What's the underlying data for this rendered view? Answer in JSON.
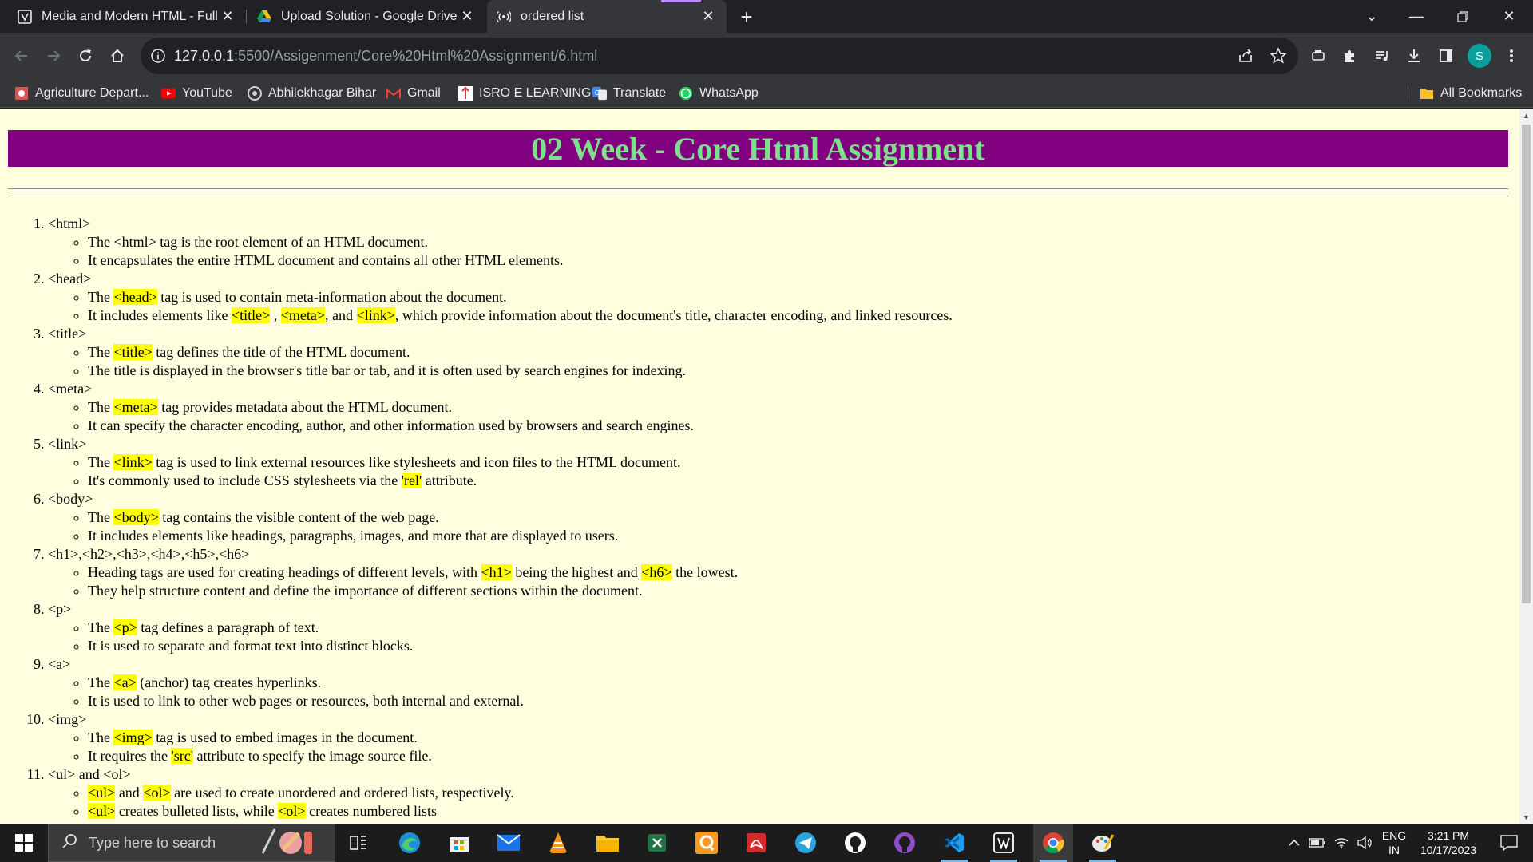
{
  "browser": {
    "tabs": [
      {
        "title": "Media and Modern HTML - Full",
        "active": false
      },
      {
        "title": "Upload Solution - Google Drive",
        "active": false
      },
      {
        "title": "ordered list",
        "active": true
      }
    ],
    "address": {
      "host": "127.0.0.1",
      "path": ":5500/Assigenment/Core%20Html%20Assignment/6.html"
    },
    "profile_initial": "S",
    "bookmarks": [
      "Agriculture Depart...",
      "YouTube",
      "Abhilekhagar Bihar",
      "Gmail",
      "ISRO E LEARNING",
      "Translate",
      "WhatsApp"
    ],
    "all_bookmarks": "All Bookmarks"
  },
  "page": {
    "heading": "02 Week - Core Html Assignment",
    "items": [
      {
        "tag": "<html>",
        "points": [
          [
            {
              "t": "The <html> tag is the root element of an HTML document."
            }
          ],
          [
            {
              "t": "It encapsulates the entire HTML document and contains all other HTML elements."
            }
          ]
        ]
      },
      {
        "tag": "<head>",
        "points": [
          [
            {
              "t": "The "
            },
            {
              "t": "<head>",
              "h": true
            },
            {
              "t": " tag is used to contain meta-information about the document."
            }
          ],
          [
            {
              "t": "It includes elements like "
            },
            {
              "t": "<title>",
              "h": true
            },
            {
              "t": " , "
            },
            {
              "t": "<meta>",
              "h": true
            },
            {
              "t": ", and "
            },
            {
              "t": "<link>",
              "h": true
            },
            {
              "t": ", which provide information about the document's title, character encoding, and linked resources."
            }
          ]
        ]
      },
      {
        "tag": "<title>",
        "points": [
          [
            {
              "t": "The "
            },
            {
              "t": "<title>",
              "h": true
            },
            {
              "t": " tag defines the title of the HTML document."
            }
          ],
          [
            {
              "t": "The title is displayed in the browser's title bar or tab, and it is often used by search engines for indexing."
            }
          ]
        ]
      },
      {
        "tag": "<meta>",
        "points": [
          [
            {
              "t": "The "
            },
            {
              "t": "<meta>",
              "h": true
            },
            {
              "t": " tag provides metadata about the HTML document."
            }
          ],
          [
            {
              "t": "It can specify the character encoding, author, and other information used by browsers and search engines."
            }
          ]
        ]
      },
      {
        "tag": "<link>",
        "points": [
          [
            {
              "t": "The "
            },
            {
              "t": "<link>",
              "h": true
            },
            {
              "t": " tag is used to link external resources like stylesheets and icon files to the HTML document."
            }
          ],
          [
            {
              "t": "It's commonly used to include CSS stylesheets via the "
            },
            {
              "t": "'rel'",
              "h": true
            },
            {
              "t": " attribute."
            }
          ]
        ]
      },
      {
        "tag": "<body>",
        "points": [
          [
            {
              "t": "The "
            },
            {
              "t": "<body>",
              "h": true
            },
            {
              "t": " tag contains the visible content of the web page."
            }
          ],
          [
            {
              "t": "It includes elements like headings, paragraphs, images, and more that are displayed to users."
            }
          ]
        ]
      },
      {
        "tag": "<h1>,<h2>,<h3>,<h4>,<h5>,<h6>",
        "points": [
          [
            {
              "t": "Heading tags are used for creating headings of different levels, with "
            },
            {
              "t": "<h1>",
              "h": true
            },
            {
              "t": " being the highest and "
            },
            {
              "t": "<h6>",
              "h": true
            },
            {
              "t": " the lowest."
            }
          ],
          [
            {
              "t": "They help structure content and define the importance of different sections within the document."
            }
          ]
        ]
      },
      {
        "tag": "<p>",
        "points": [
          [
            {
              "t": "The "
            },
            {
              "t": "<p>",
              "h": true
            },
            {
              "t": " tag defines a paragraph of text."
            }
          ],
          [
            {
              "t": "It is used to separate and format text into distinct blocks."
            }
          ]
        ]
      },
      {
        "tag": "<a>",
        "points": [
          [
            {
              "t": "The "
            },
            {
              "t": "<a>",
              "h": true
            },
            {
              "t": " (anchor) tag creates hyperlinks."
            }
          ],
          [
            {
              "t": "It is used to link to other web pages or resources, both internal and external."
            }
          ]
        ]
      },
      {
        "tag": "<img>",
        "points": [
          [
            {
              "t": "The "
            },
            {
              "t": "<img>",
              "h": true
            },
            {
              "t": " tag is used to embed images in the document."
            }
          ],
          [
            {
              "t": "It requires the "
            },
            {
              "t": "'src'",
              "h": true
            },
            {
              "t": " attribute to specify the image source file."
            }
          ]
        ]
      },
      {
        "tag": "<ul> and <ol>",
        "points": [
          [
            {
              "t": "<ul>",
              "h": true
            },
            {
              "t": " and "
            },
            {
              "t": "<ol>",
              "h": true
            },
            {
              "t": " are used to create unordered and ordered lists, respectively."
            }
          ],
          [
            {
              "t": "<ul>",
              "h": true
            },
            {
              "t": " creates bulleted lists, while "
            },
            {
              "t": "<ol>",
              "h": true
            },
            {
              "t": " creates numbered lists"
            }
          ]
        ]
      }
    ]
  },
  "taskbar": {
    "search_placeholder": "Type here to search",
    "lang_line1": "ENG",
    "lang_line2": "IN",
    "time": "3:21 PM",
    "date": "10/17/2023"
  }
}
